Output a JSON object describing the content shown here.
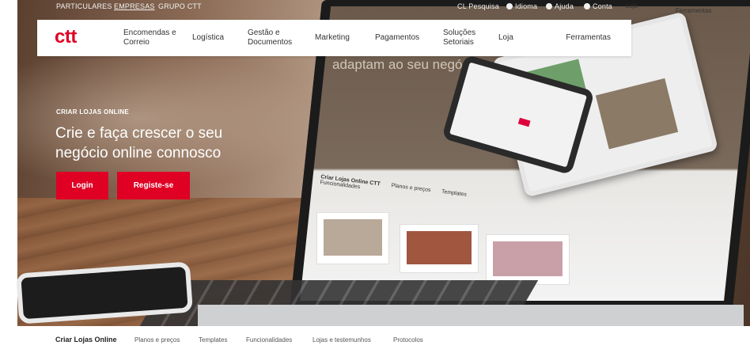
{
  "utility_bar": {
    "left_links": [
      "PARTICULARES",
      "EMPRESAS",
      "GRUPO CTT"
    ],
    "right_links": [
      "Pesquisa",
      "Idioma",
      "Ajuda",
      "Conta"
    ],
    "search_prefix": "CL",
    "dropdown_labels": [
      "Loja",
      "Ferramentas"
    ]
  },
  "nav": {
    "logo": "ctt",
    "items": [
      "Encomendas e Correio",
      "Logística",
      "Gestão e Documentos",
      "Marketing",
      "Pagamentos",
      "Soluções Setoriais",
      "Loja",
      "Ferramentas"
    ]
  },
  "hero": {
    "eyebrow": "CRIAR LOJAS ONLINE",
    "headline": "Crie e faça crescer o seu negócio online connosco",
    "login_label": "Login",
    "register_label": "Registe-se"
  },
  "laptop_screen": {
    "tagline": "adaptam ao seu negócio",
    "subnav": [
      "Criar Lojas Online CTT",
      "Planos e preços",
      "Templates",
      "Funcionalidades"
    ]
  },
  "bottom_nav": {
    "items": [
      "Criar Lojas Online",
      "Planos e preços",
      "Templates",
      "Funcionalidades",
      "Lojas e testemunhos",
      "Protocolos"
    ]
  },
  "colors": {
    "brand_red": "#df0024"
  }
}
